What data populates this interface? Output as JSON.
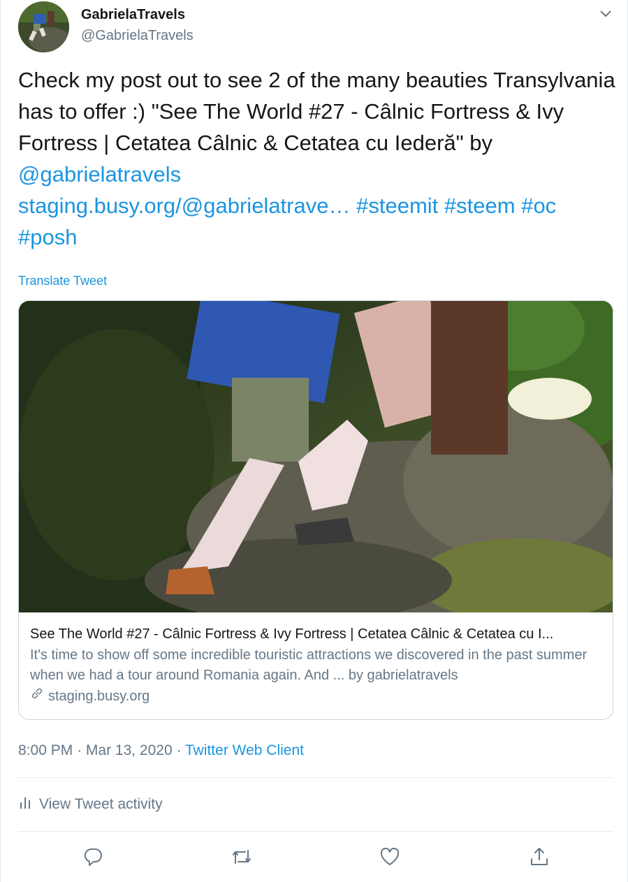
{
  "author": {
    "display_name": "GabrielaTravels",
    "handle": "@GabrielaTravels"
  },
  "tweet": {
    "text_parts": [
      "Check my post out to see 2 of the many beauties Transylvania has to offer :) \"See The World #27 - Câlnic Fortress & Ivy Fortress | Cetatea Câlnic & Cetatea cu Iederă\" by "
    ],
    "mention": "@gabrielatravels",
    "link": "staging.busy.org/@gabrielatrave…",
    "hashtags": [
      "#steemit",
      "#steem",
      "#oc",
      "#posh"
    ]
  },
  "translate_label": "Translate Tweet",
  "card": {
    "title": "See The World #27 - Câlnic Fortress & Ivy Fortress | Cetatea Câlnic & Cetatea cu I...",
    "description": "It's time to show off some incredible touristic attractions we discovered in the past summer when we had a tour around Romania again. And ... by gabrielatravels",
    "domain": "staging.busy.org"
  },
  "meta": {
    "time": "8:00 PM",
    "separator": "·",
    "date": "Mar 13, 2020",
    "client": "Twitter Web Client"
  },
  "activity_label": "View Tweet activity",
  "colors": {
    "link": "#1b95e0",
    "secondary_text": "#657786",
    "border": "#e6ecf0"
  },
  "icons": [
    "chevron-down-icon",
    "bar-chart-icon",
    "reply-icon",
    "retweet-icon",
    "like-icon",
    "share-icon",
    "link-icon"
  ]
}
